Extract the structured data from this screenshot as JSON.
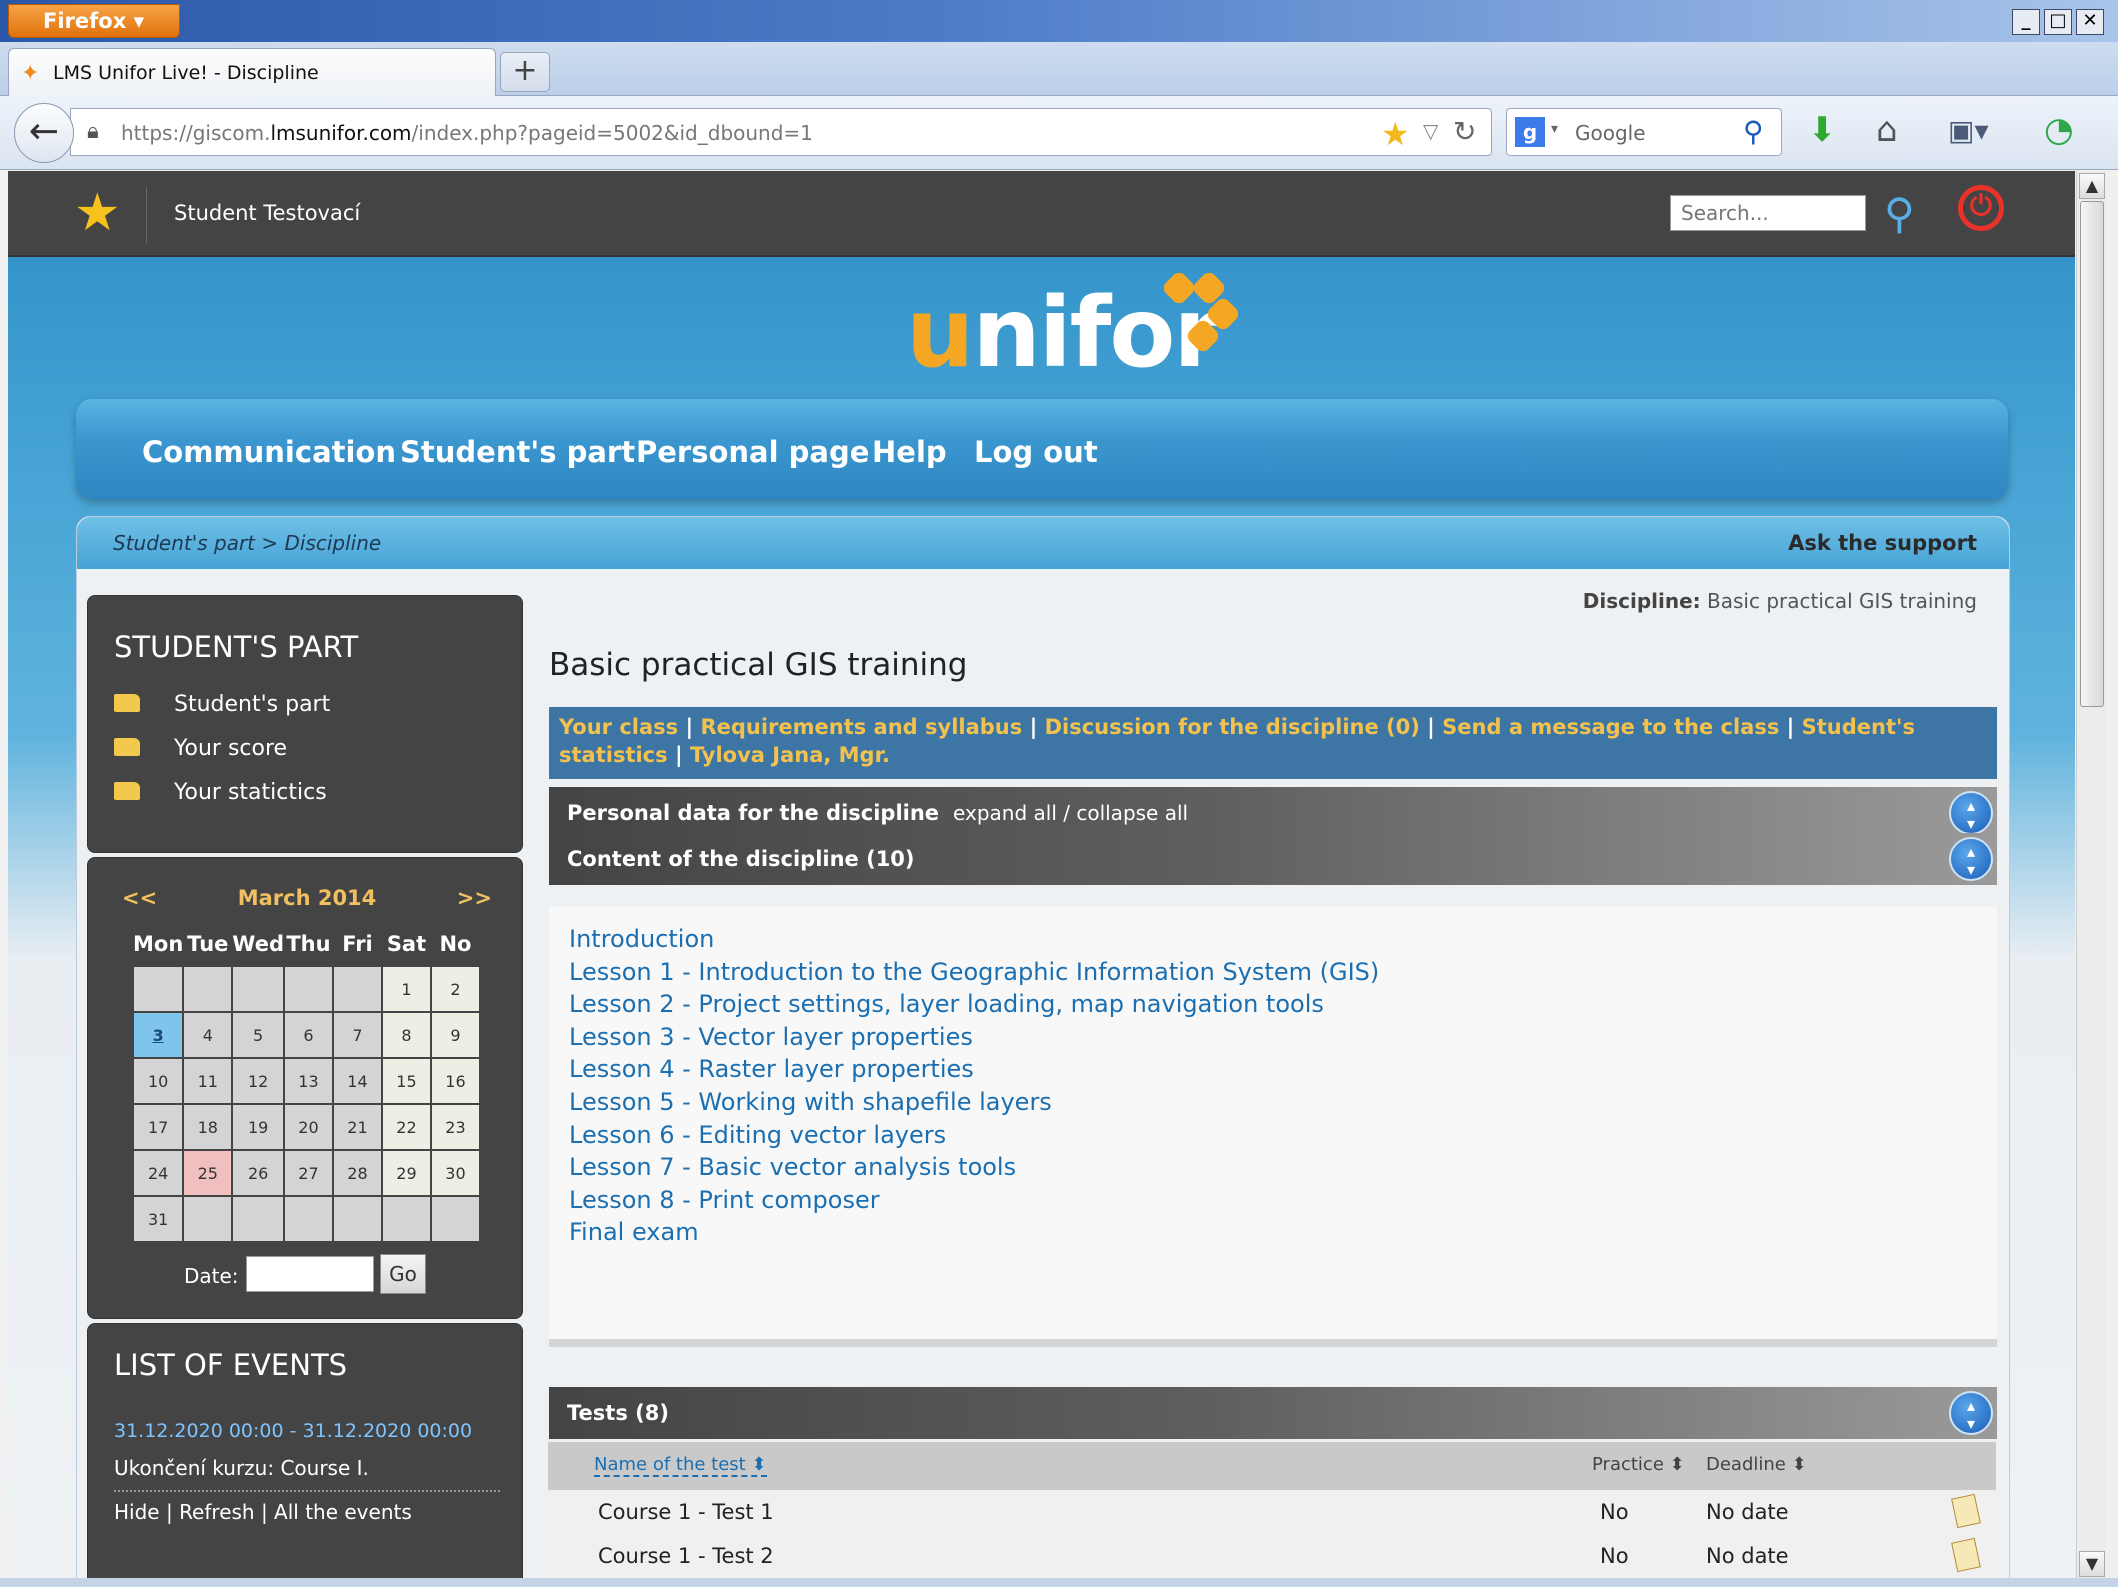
{
  "browser": {
    "app_button": "Firefox",
    "tab_title": "LMS Unifor Live! - Discipline",
    "url_prefix": "https://giscom.",
    "url_domain": "lmsunifor.com",
    "url_path": "/index.php?pageid=5002&id_dbound=1",
    "search_engine_label": "Google",
    "window_buttons": [
      "_",
      "□",
      "✕"
    ]
  },
  "topbar": {
    "username": "Student Testovací",
    "search_placeholder": "Search..."
  },
  "logo": {
    "text_u": "u",
    "text_rest": "nifor"
  },
  "menu": {
    "items": [
      "Communication",
      "Student's part",
      "Personal page",
      "Help",
      "Log out"
    ]
  },
  "breadcrumb": {
    "path": "Student's part > Discipline",
    "ask_support": "Ask the support"
  },
  "sidebar": {
    "students_part": {
      "title": "STUDENT'S PART",
      "items": [
        "Student's part",
        "Your score",
        "Your statictics"
      ]
    },
    "calendar": {
      "prev": "<<",
      "title": "March 2014",
      "next": ">>",
      "weekdays": [
        "Mon",
        "Tue",
        "Wed",
        "Thu",
        "Fri",
        "Sat",
        "No"
      ],
      "weeks": [
        [
          "",
          "",
          "",
          "",
          "",
          "1",
          "2"
        ],
        [
          "3",
          "4",
          "5",
          "6",
          "7",
          "8",
          "9"
        ],
        [
          "10",
          "11",
          "12",
          "13",
          "14",
          "15",
          "16"
        ],
        [
          "17",
          "18",
          "19",
          "20",
          "21",
          "22",
          "23"
        ],
        [
          "24",
          "25",
          "26",
          "27",
          "28",
          "29",
          "30"
        ],
        [
          "31",
          "",
          "",
          "",
          "",
          "",
          ""
        ]
      ],
      "today": "3",
      "marked": "25",
      "date_label": "Date:",
      "date_value": "",
      "go_label": "Go"
    },
    "events": {
      "title": "LIST OF EVENTS",
      "range": "31.12.2020 00:00 - 31.12.2020 00:00",
      "text": "Ukončení kurzu: Course I.",
      "links": [
        "Hide",
        "Refresh",
        "All the events"
      ]
    }
  },
  "discipline": {
    "label": "Discipline:",
    "name": "Basic practical GIS training",
    "title": "Basic practical GIS training",
    "links": [
      "Your class",
      "Requirements and syllabus",
      "Discussion for the discipline (0)",
      "Send a message to the class",
      "Student's statistics",
      "Tylova Jana, Mgr."
    ],
    "personal_section": "Personal data for the discipline",
    "expand_collapse": "expand all / collapse all",
    "content_section": "Content of the discipline (10)",
    "lessons": [
      "Introduction",
      "Lesson 1 - Introduction to the Geographic Information System (GIS)",
      "Lesson 2 - Project settings, layer loading, map navigation tools",
      "Lesson 3 - Vector layer properties",
      "Lesson 4 - Raster layer properties",
      "Lesson 5 - Working with shapefile layers",
      "Lesson 6 - Editing vector layers",
      "Lesson 7 - Basic vector analysis tools",
      "Lesson 8 - Print composer",
      "Final exam"
    ],
    "tests_section": "Tests (8)",
    "tests_columns": [
      "Name of the test",
      "Practice",
      "Deadline"
    ],
    "tests": [
      {
        "name": "Course 1 - Test 1",
        "practice": "No",
        "deadline": "No date"
      },
      {
        "name": "Course 1 - Test 2",
        "practice": "No",
        "deadline": "No date"
      }
    ]
  }
}
